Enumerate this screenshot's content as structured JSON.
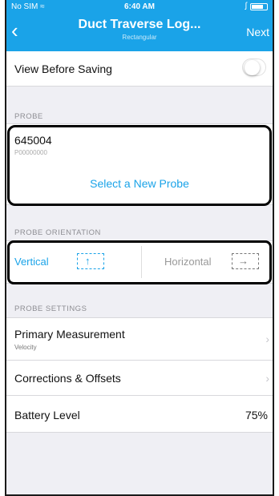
{
  "status": {
    "carrier": "No SIM ≈",
    "time": "6:40 AM",
    "bluetooth": "ʃ"
  },
  "nav": {
    "back_icon": "‹",
    "title": "Duct Traverse Log...",
    "subtitle": "Rectangular",
    "next_label": "Next"
  },
  "view_before_saving": {
    "label": "View Before Saving",
    "toggle_on": false
  },
  "probe": {
    "header": "PROBE",
    "id": "645004",
    "subtext": "P00000000",
    "select_label": "Select a New Probe"
  },
  "orientation": {
    "header": "PROBE ORIENTATION",
    "vertical_label": "Vertical",
    "horizontal_label": "Horizontal",
    "selected": "Vertical",
    "vertical_arrow": "↑",
    "horizontal_arrow": "→"
  },
  "settings": {
    "header": "PROBE SETTINGS",
    "primary_label": "Primary Measurement",
    "primary_value": "Velocity",
    "corrections_label": "Corrections & Offsets",
    "battery_label": "Battery Level",
    "battery_value": "75%",
    "chevron": "›"
  },
  "colors": {
    "accent": "#1aa3e8",
    "background": "#efeff4"
  }
}
